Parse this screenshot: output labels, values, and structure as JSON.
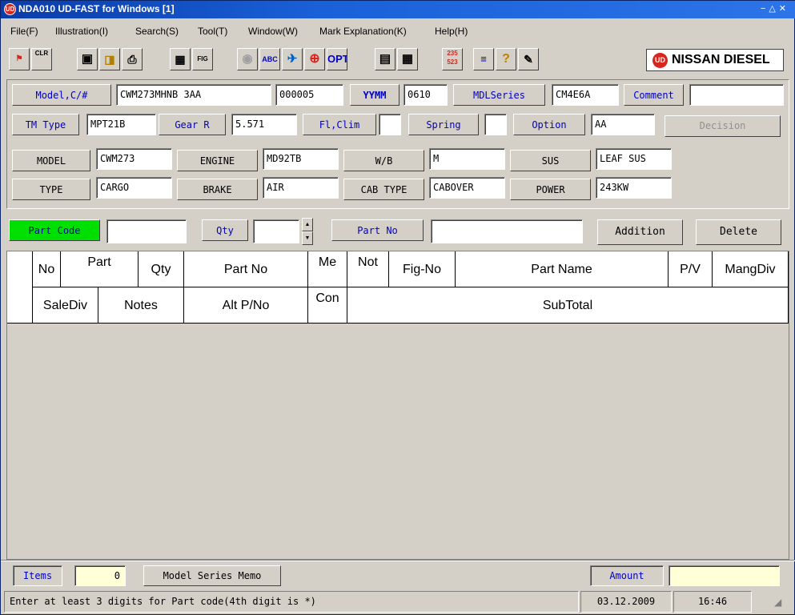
{
  "window": {
    "title": "NDA010 UD-FAST for Windows [1]",
    "logo_text": "UD",
    "buttons": "= ^ x"
  },
  "menu": [
    "File(F)",
    "Illustration(I)",
    "Search(S)",
    "Tool(T)",
    "Window(W)",
    "Mark Explanation(K)",
    "Help(H)"
  ],
  "toolbar": {
    "clr_label": "CLR",
    "abc_label": "ABC",
    "opt_label": "OPT",
    "fig_label": "FIG",
    "num_label": "235\n523",
    "brand_logo": "UD",
    "brand_text": "NISSAN DIESEL"
  },
  "header": {
    "model_cno_label": "Model,C/#",
    "model_cno_value": "CWM273MHNB    3AA",
    "serial_value": "000005",
    "yymm_label": "YYMM",
    "yymm_value": "0610",
    "mdlseries_label": "MDLSeries",
    "mdlseries_value": "CM4E6A",
    "comment_label": "Comment",
    "comment_value": "",
    "tm_type_label": "TM Type",
    "tm_type_value": "MPT21B",
    "gear_r_label": "Gear R",
    "gear_r_value": "5.571",
    "fl_clim_label": "Fl,Clim",
    "fl_clim_value": "",
    "spring_label": "Spring",
    "spring_value": "",
    "option_label": "Option",
    "option_value": "AA",
    "decision_label": "Decision"
  },
  "specs": {
    "model_label": "MODEL",
    "model_value": "CWM273",
    "engine_label": "ENGINE",
    "engine_value": "MD92TB",
    "wb_label": "W/B",
    "wb_value": "M",
    "sus_label": "SUS",
    "sus_value": "LEAF SUS",
    "type_label": "TYPE",
    "type_value": "CARGO",
    "brake_label": "BRAKE",
    "brake_value": "AIR",
    "cab_type_label": "CAB TYPE",
    "cab_type_value": "CABOVER",
    "power_label": "POWER",
    "power_value": "243KW"
  },
  "parts_entry": {
    "part_code_label": "Part Code",
    "part_code_value": "",
    "qty_label": "Qty",
    "qty_value": "",
    "part_no_label": "Part No",
    "part_no_value": "",
    "addition_label": "Addition",
    "delete_label": "Delete"
  },
  "grid": {
    "row1": [
      "No",
      "Part",
      "Qty",
      "Part No",
      "Me",
      "Not",
      "Fig-No",
      "Part Name",
      "P/V",
      "MangDiv"
    ],
    "row2": [
      "SaleDiv",
      "Notes",
      "Alt P/No",
      "Con",
      "SubTotal"
    ]
  },
  "footer": {
    "items_label": "Items",
    "items_value": "0",
    "memo_label": "Model Series Memo",
    "amount_label": "Amount",
    "amount_value": "",
    "status_message": "Enter at least 3 digits for Part code(4th digit is *)",
    "date": "03.12.2009",
    "time": "16:46"
  }
}
